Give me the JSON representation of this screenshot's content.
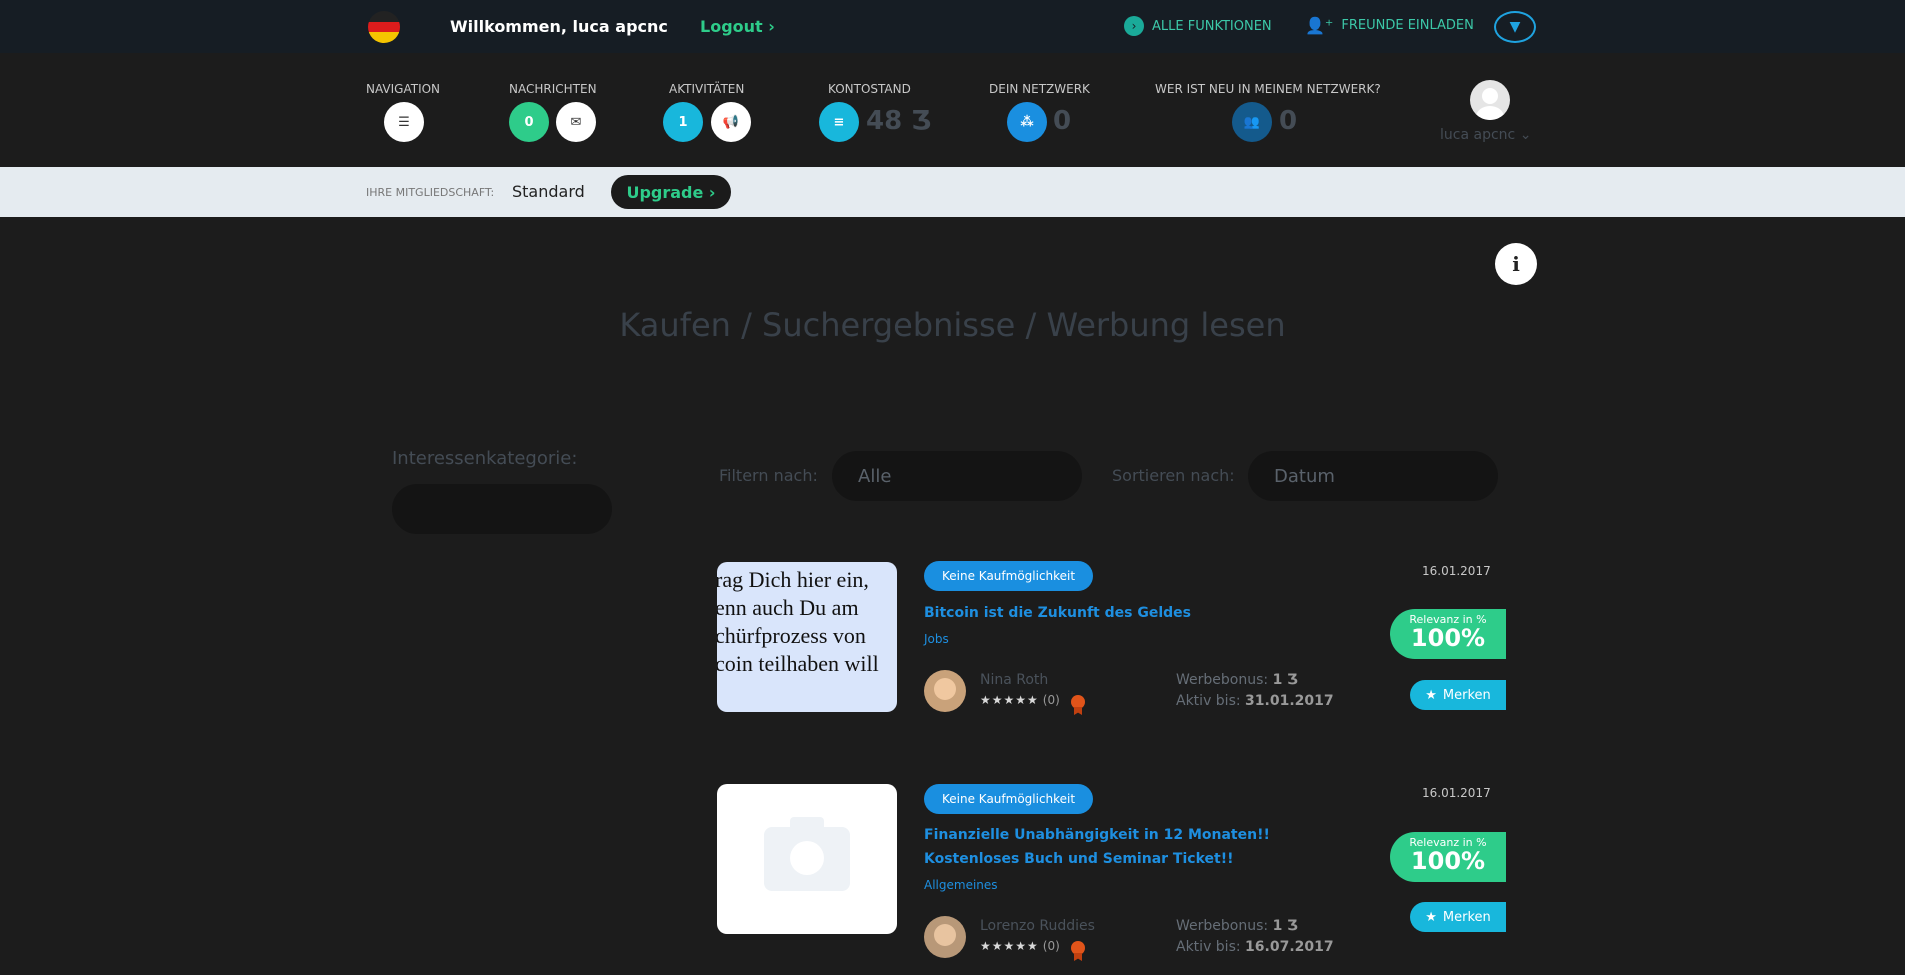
{
  "header": {
    "welcome": "Willkommen, luca apcnc",
    "logout": "Logout",
    "all_functions": "ALLE FUNKTIONEN",
    "invite_friends": "FREUNDE EINLADEN"
  },
  "stats": {
    "navigation_label": "NAVIGATION",
    "messages_label": "NACHRICHTEN",
    "messages_count": "0",
    "activities_label": "AKTIVITÄTEN",
    "activities_count": "1",
    "balance_label": "KONTOSTAND",
    "balance_value": "48 Ʒ",
    "network_label": "DEIN NETZWERK",
    "network_value": "0",
    "new_in_network_label": "WER IST NEU IN MEINEM NETZWERK?",
    "new_in_network_value": "0",
    "username": "luca apcnc"
  },
  "membership": {
    "label": "IHRE MITGLIEDSCHAFT:",
    "value": "Standard",
    "upgrade": "Upgrade"
  },
  "page": {
    "title": "Kaufen / Suchergebnisse / Werbung lesen",
    "interest_label": "Interessenkategorie:",
    "filter_label": "Filtern nach:",
    "filter_value": "Alle",
    "sort_label": "Sortieren nach:",
    "sort_value": "Datum"
  },
  "listings": [
    {
      "badge": "Keine Kaufmöglichkeit",
      "title": "Bitcoin ist die Zukunft des Geldes",
      "category": "Jobs",
      "thumb_lines": [
        "rag Dich hier ein,",
        "enn auch Du am",
        "chürfprozess von",
        "coin teilhaben will"
      ],
      "author": "Nina Roth",
      "rating_count": "(0)",
      "bonus_label": "Werbebonus:",
      "bonus_value": "1 Ʒ",
      "active_label": "Aktiv bis:",
      "active_value": "31.01.2017",
      "date": "16.01.2017",
      "relevance_label": "Relevanz in %",
      "relevance_value": "100%",
      "merken": "Merken"
    },
    {
      "badge": "Keine Kaufmöglichkeit",
      "title": "Finanzielle Unabhängigkeit in 12 Monaten!! Kostenloses Buch und Seminar Ticket!!",
      "category": "Allgemeines",
      "author": "Lorenzo Ruddies",
      "rating_count": "(0)",
      "bonus_label": "Werbebonus:",
      "bonus_value": "1 Ʒ",
      "active_label": "Aktiv bis:",
      "active_value": "16.07.2017",
      "date": "16.01.2017",
      "relevance_label": "Relevanz in %",
      "relevance_value": "100%",
      "merken": "Merken"
    }
  ],
  "colors": {
    "accent_green": "#2ecc8a",
    "accent_blue": "#1a8fe0",
    "teal": "#18b7dc"
  }
}
